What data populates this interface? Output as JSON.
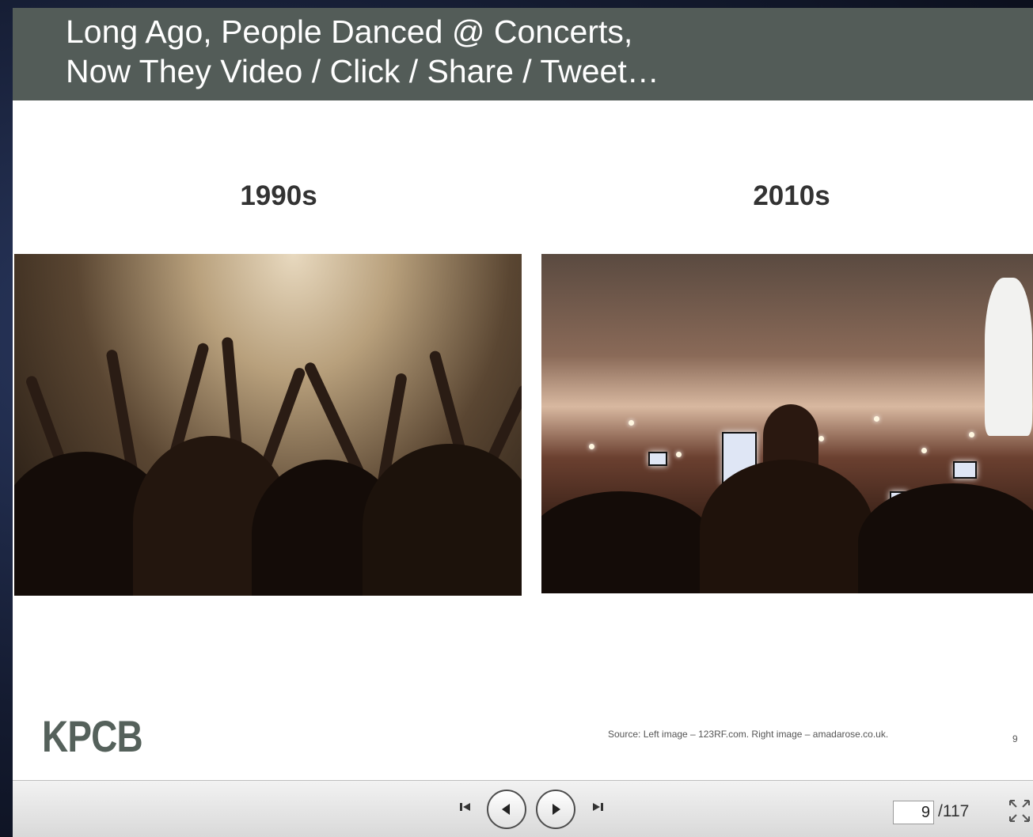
{
  "slide": {
    "title_line_1": "Long Ago, People Danced @ Concerts,",
    "title_line_2": "Now They Video / Click / Share / Tweet…",
    "left_caption": "1990s",
    "right_caption": "2010s",
    "logo_text": "KPCB",
    "source_text": "Source: Left image – 123RF.com. Right image – amadarose.co.uk.",
    "slide_number": "9"
  },
  "player": {
    "first_icon": "first-slide-icon",
    "prev_icon": "previous-slide-icon",
    "next_icon": "next-slide-icon",
    "last_icon": "last-slide-icon",
    "current_page": "9",
    "total_pages": "/117",
    "fullscreen_icon": "fullscreen-icon"
  },
  "colors": {
    "title_bar": "#535c58",
    "logo": "#55615b",
    "toolbar": "#e6e6e6"
  }
}
